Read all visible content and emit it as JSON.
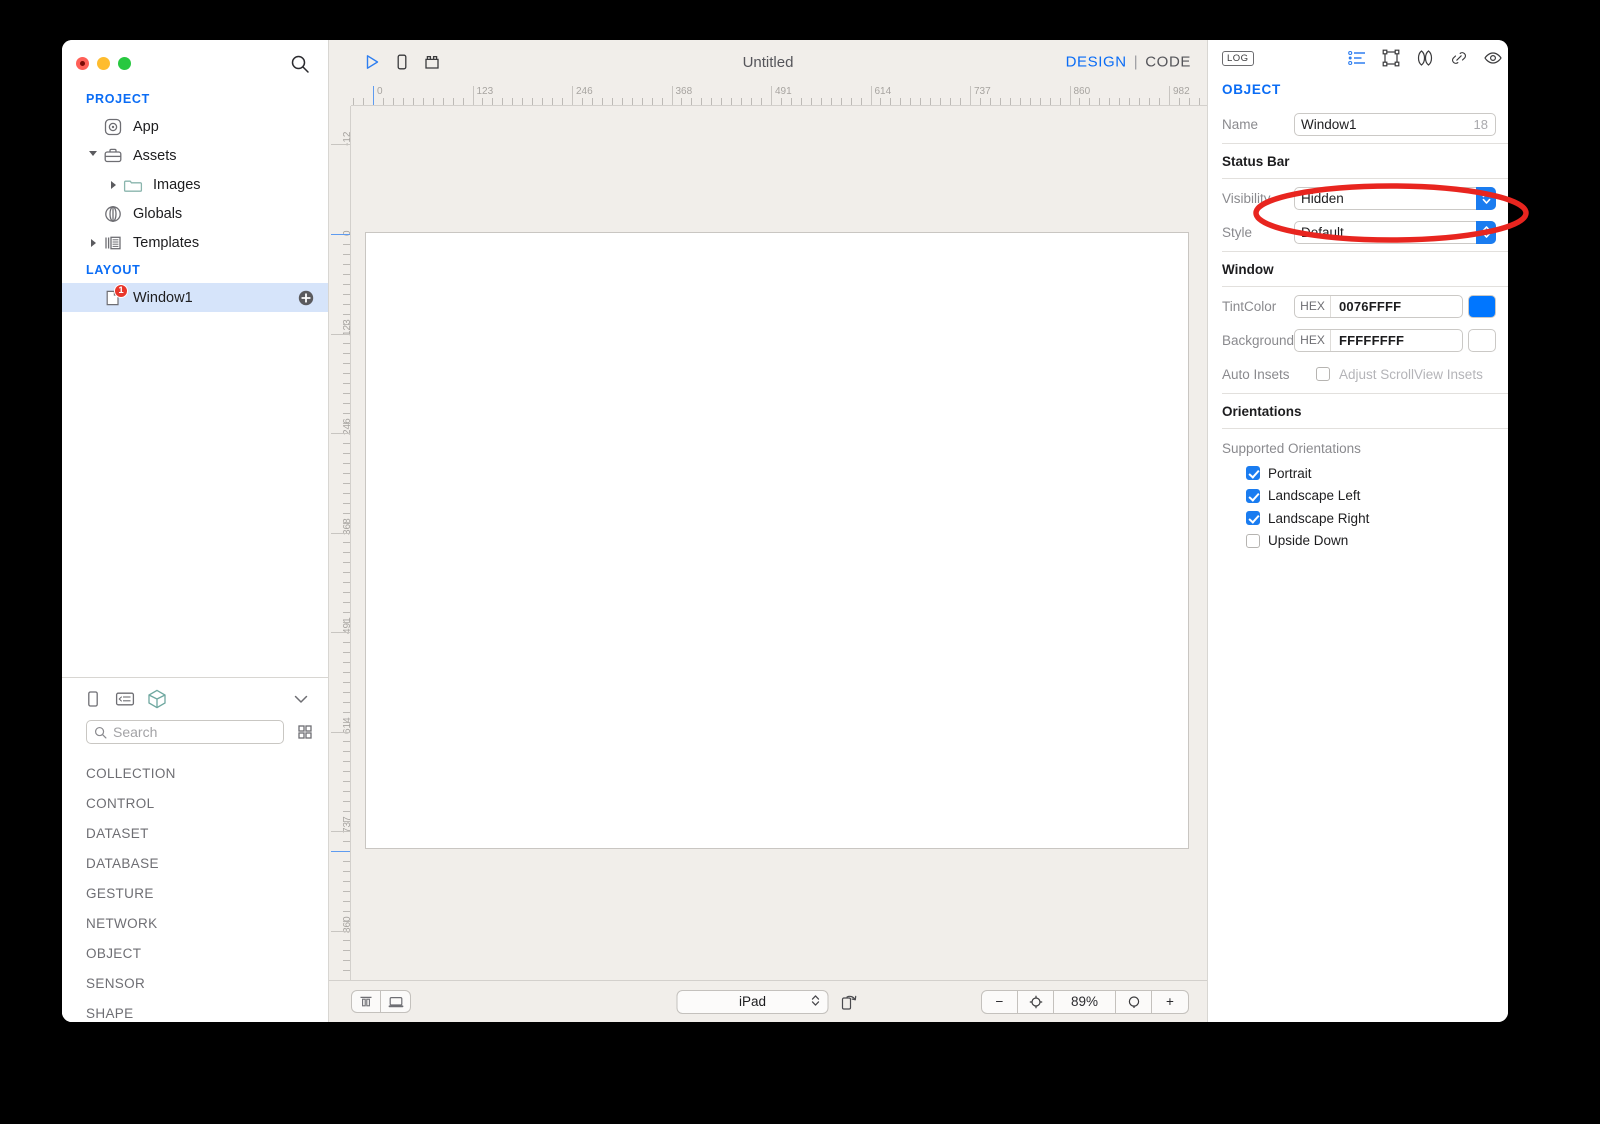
{
  "window": {
    "title": "Untitled",
    "traffic_lights": [
      "close",
      "minimize",
      "zoom"
    ]
  },
  "sidebar": {
    "search_icon": "search-icon",
    "sections": [
      {
        "header": "PROJECT",
        "items": [
          {
            "label": "App",
            "icon": "app-icon",
            "indent": 0,
            "disclosure": "none",
            "selected": false
          },
          {
            "label": "Assets",
            "icon": "assets-briefcase-icon",
            "indent": 0,
            "disclosure": "open",
            "selected": false
          },
          {
            "label": "Images",
            "icon": "folder-icon",
            "indent": 1,
            "disclosure": "closed",
            "selected": false
          },
          {
            "label": "Globals",
            "icon": "globals-icon",
            "indent": 0,
            "disclosure": "none",
            "selected": false
          },
          {
            "label": "Templates",
            "icon": "templates-icon",
            "indent": 0,
            "disclosure": "closed",
            "selected": false
          }
        ]
      },
      {
        "header": "LAYOUT",
        "items": [
          {
            "label": "Window1",
            "icon": "window-doc-icon",
            "indent": 0,
            "disclosure": "none",
            "selected": true,
            "badge": "1",
            "add_button": "add-icon"
          }
        ]
      }
    ]
  },
  "library": {
    "tools": [
      "panel-icon",
      "outline-icon",
      "object-3d-icon"
    ],
    "collapse_icon": "chevron-down-icon",
    "search": {
      "placeholder": "Search",
      "value": "",
      "icon": "search-icon"
    },
    "grid_toggle_icon": "grid-view-icon",
    "categories": [
      "COLLECTION",
      "CONTROL",
      "DATASET",
      "DATABASE",
      "GESTURE",
      "NETWORK",
      "OBJECT",
      "SENSOR",
      "SHAPE"
    ]
  },
  "canvas": {
    "toolbar": {
      "run_icon": "play-run-icon",
      "device_icon": "device-preview-icon",
      "components_icon": "components-icon",
      "title": "Untitled",
      "mode_design": "DESIGN",
      "mode_separator": "|",
      "mode_code": "CODE",
      "active_mode": "DESIGN"
    },
    "ruler_h_labels": [
      "0",
      "123",
      "246",
      "368",
      "491",
      "614",
      "737",
      "860",
      "982"
    ],
    "ruler_v_labels": [
      "-12",
      "0",
      "123",
      "246",
      "368",
      "491",
      "614",
      "737",
      "860"
    ],
    "bottom": {
      "layout_icons": [
        "align-top-icon",
        "device-frame-icon"
      ],
      "device": "iPad",
      "rotate_icon": "rotate-device-icon",
      "zoom_out": "−",
      "zoom_fit_icon": "fit-target-icon",
      "zoom_level": "89%",
      "zoom_actual_icon": "actual-size-icon",
      "zoom_in": "+"
    }
  },
  "inspector": {
    "log_button": "LOG",
    "toolbar_icons": [
      "attributes-list-icon",
      "layout-frame-icon",
      "appearance-icon",
      "connections-link-icon",
      "preview-eye-icon"
    ],
    "title": "OBJECT",
    "name_label": "Name",
    "name_value": "Window1",
    "name_suffix": "18",
    "sections": [
      {
        "header": "Status Bar",
        "rows": [
          {
            "label": "Visibility",
            "type": "combo",
            "value": "Hidden",
            "highlighted": true
          },
          {
            "label": "Style",
            "type": "combo",
            "value": "Default",
            "highlighted": false
          }
        ]
      },
      {
        "header": "Window",
        "rows": [
          {
            "label": "TintColor",
            "type": "hex",
            "hex_label": "HEX",
            "value": "0076FFFF",
            "swatch": "#0076ff"
          },
          {
            "label": "Background",
            "type": "hex",
            "hex_label": "HEX",
            "value": "FFFFFFFF",
            "swatch": "#ffffff"
          },
          {
            "label": "Auto Insets",
            "type": "checkbox",
            "value": "Adjust ScrollView Insets",
            "checked": false,
            "disabled": true
          }
        ]
      }
    ],
    "orientations": {
      "header": "Orientations",
      "label": "Supported Orientations",
      "options": [
        {
          "label": "Portrait",
          "checked": true
        },
        {
          "label": "Landscape Left",
          "checked": true
        },
        {
          "label": "Landscape Right",
          "checked": true
        },
        {
          "label": "Upside Down",
          "checked": false
        }
      ]
    }
  },
  "annotation": {
    "shape": "ellipse",
    "color": "#e8251f",
    "target": "Visibility combo box"
  },
  "colors": {
    "accent_blue": "#0a6cf5",
    "canvas_bg": "#f1eeea",
    "selection_blue": "#d6e4fa",
    "annotation_red": "#e8251f"
  }
}
